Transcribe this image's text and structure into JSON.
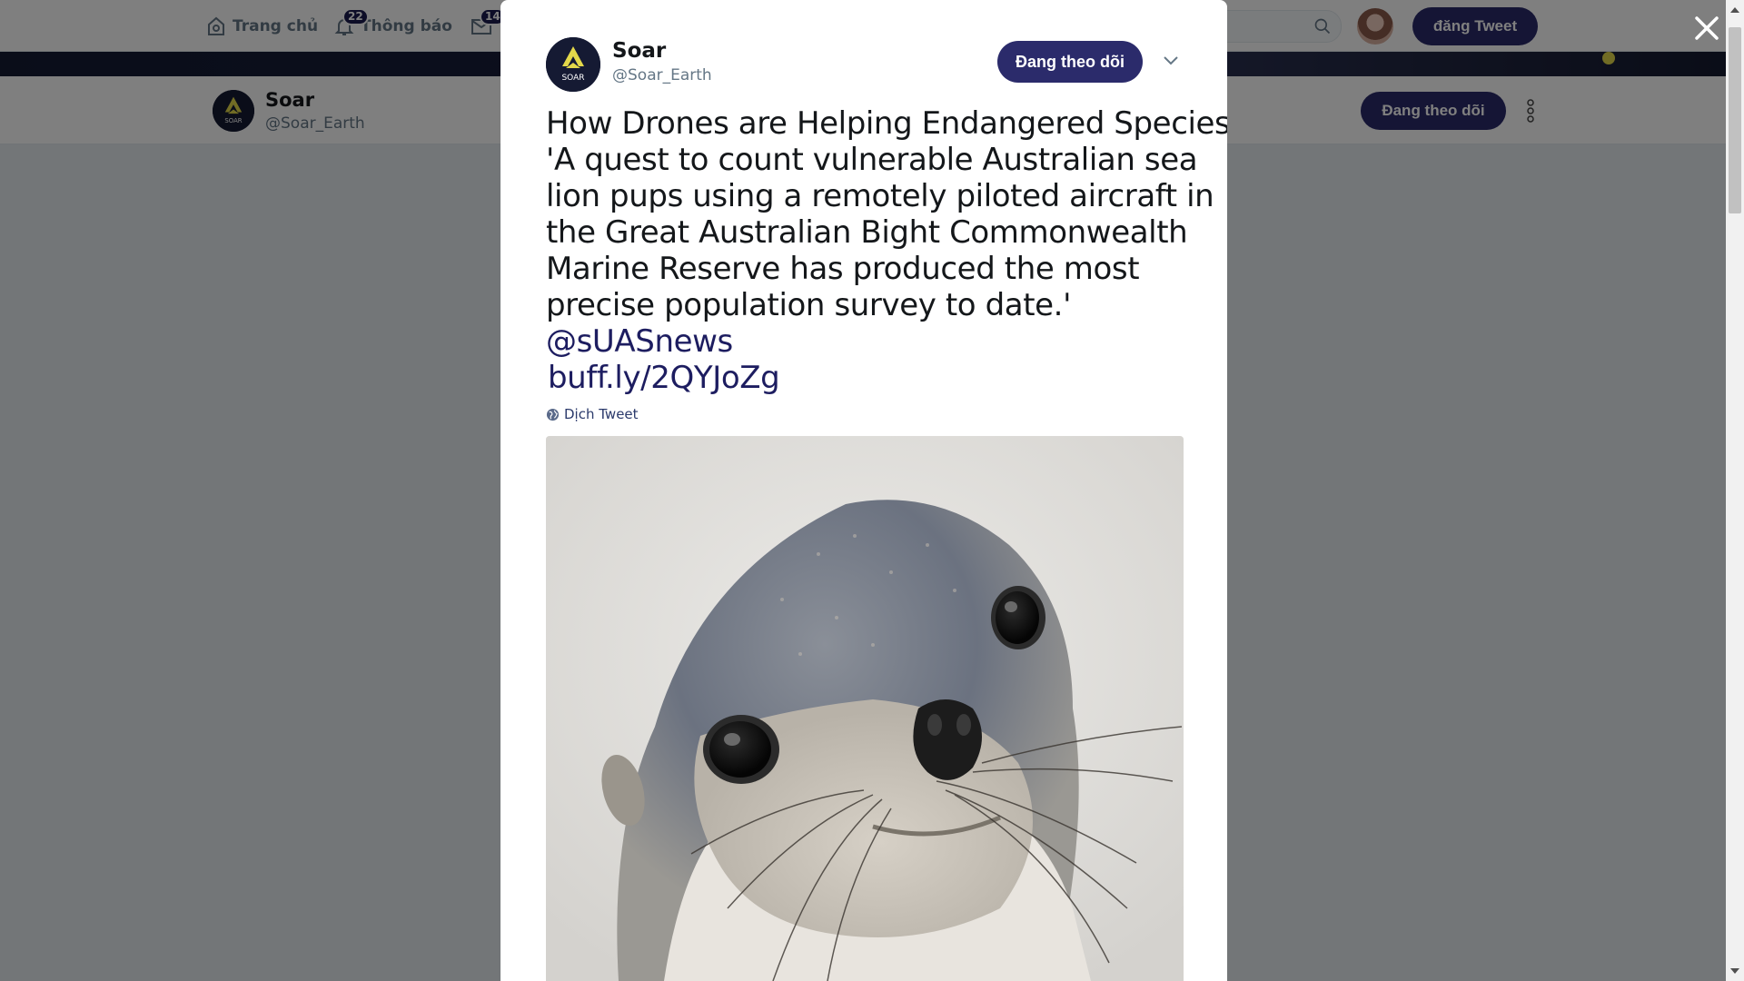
{
  "topnav": {
    "home_label": "Trang chủ",
    "notifications_label": "Thông báo",
    "notifications_count": "22",
    "messages_count": "14",
    "tweet_button": "đăng Tweet"
  },
  "profile_bar": {
    "name": "Soar",
    "handle": "@Soar_Earth",
    "follow_label": "Đang theo dõi"
  },
  "tweet": {
    "author_name": "Soar",
    "author_handle": "@Soar_Earth",
    "follow_label": "Đang theo dõi",
    "text_lines": [
      "How Drones are Helping Endangered Species",
      "'A quest to count vulnerable Australian sea",
      "lion pups using a remotely piloted aircraft in",
      "the Great Australian Bight Commonwealth",
      "Marine Reserve has produced the most",
      "precise population survey to date.'"
    ],
    "mention": "@sUASnews",
    "link": "buff.ly/2QYJoZg",
    "translate_label": "Dịch Tweet",
    "image_subject": "sea-lion-pup-photo"
  },
  "colors": {
    "brand_dark": "#2b2b6b",
    "link": "#1d1d60",
    "logo_yellow": "#e3d84a"
  }
}
